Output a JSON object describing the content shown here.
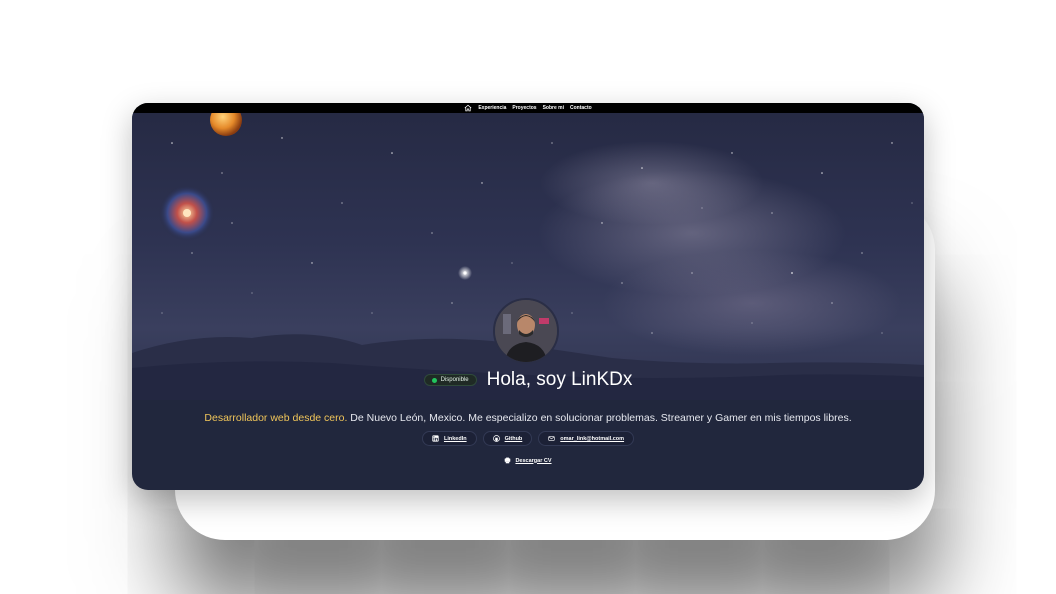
{
  "nav": {
    "home_icon": "home-icon",
    "items": [
      "Experiencia",
      "Proyectos",
      "Sobre mi",
      "Contacto"
    ]
  },
  "hero": {
    "badge": "Disponible",
    "title": "Hola, soy LinKDx"
  },
  "description": {
    "highlight": "Desarrollador web desde cero.",
    "rest": " De Nuevo León, Mexico. Me especializo en solucionar problemas. Streamer y Gamer en mis tiempos libres."
  },
  "links": [
    {
      "label": "LinkedIn",
      "icon": "linkedin-icon"
    },
    {
      "label": "Github",
      "icon": "github-icon"
    },
    {
      "label": "omar_link@hotmail.com",
      "icon": "mail-icon"
    }
  ],
  "cv": {
    "label": "Descargar CV",
    "icon": "download-icon"
  },
  "colors": {
    "accent": "#f1c65a",
    "status": "#22c55e",
    "card_bg": "#21273d"
  }
}
